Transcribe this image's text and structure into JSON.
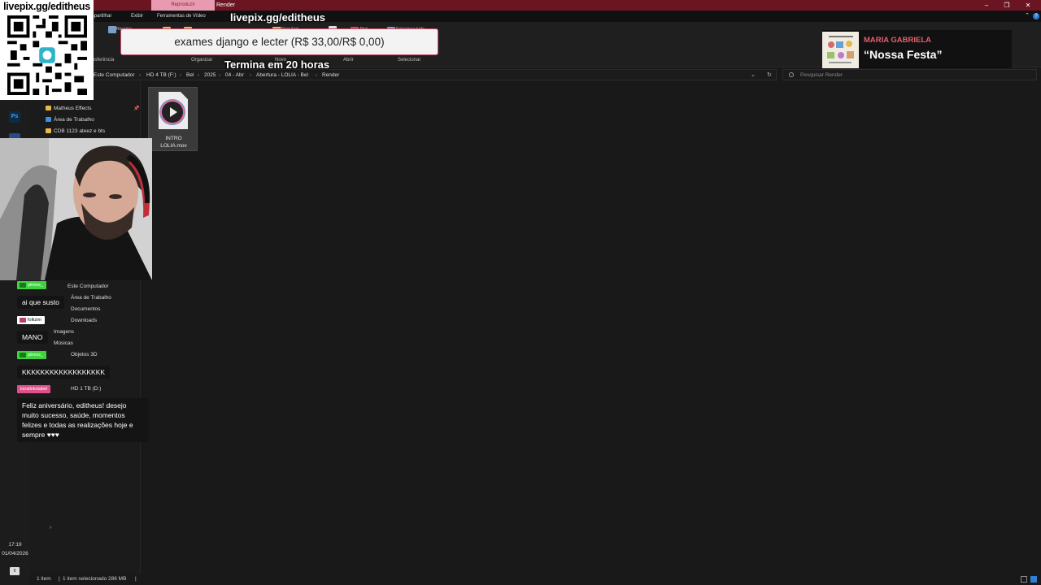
{
  "window": {
    "title": "Render",
    "context_tab": "Reproduzir",
    "controls": [
      "–",
      "❐",
      "✕"
    ]
  },
  "ribbon_tabs": {
    "share": "Compartilhar",
    "view": "Exibir",
    "video_tools": "Ferramentas de Vídeo"
  },
  "ribbon": {
    "groups": {
      "transfer": "Transferência",
      "organize": "Organizar",
      "new": "Novo",
      "open": "Abrir",
      "select": "Selecionar"
    },
    "items": {
      "cut": "Recortar",
      "new_item": "Novo item",
      "open": "Abrir",
      "select_all": "Selecionar tudo"
    }
  },
  "address": {
    "crumbs": [
      "Este Computador",
      "HD 4 TB (F:)",
      "Bel",
      "2025",
      "04 - Abr",
      "Abertura - LOLIA - Bel",
      "Render"
    ],
    "search_placeholder": "Pesquisar Render"
  },
  "taskbar": {
    "ps_label": "Ps",
    "time": "17:19",
    "date": "01/04/2026",
    "notif_count": "9"
  },
  "nav": {
    "quick_access": [
      {
        "label": "Matheus Effects",
        "color": "#e8b94a"
      },
      {
        "label": "Área de Trabalho",
        "color": "#3d8fe0"
      },
      {
        "label": "CDB 1123 ateez e bts",
        "color": "#e8b94a"
      }
    ],
    "this_pc": [
      {
        "label": "Este Computador"
      },
      {
        "label": "Área de Trabalho"
      },
      {
        "label": "Documentos"
      },
      {
        "label": "Downloads"
      },
      {
        "label": "Imagens"
      },
      {
        "label": "Músicas"
      },
      {
        "label": "Objetos 3D"
      },
      {
        "label": "HD 1 TB (D:)"
      }
    ]
  },
  "files": [
    {
      "name": "INTRO LOLIA.mov",
      "line1": "INTRO",
      "line2": "LOLIA.mov"
    }
  ],
  "status": {
    "count": "1 item",
    "selected": "1 item selecionado  286 MB"
  },
  "overlay": {
    "qr_url": "livepix.gg/editheus",
    "goal_title": "livepix.gg/editheus",
    "goal_text": "exames django e lecter (R$ 33,00/R$ 0,00)",
    "goal_ends": "Termina em 20 horas",
    "music": {
      "artist": "MARIA GABRIELA",
      "song": "“Nossa Festa”"
    }
  },
  "chat": [
    {
      "user": "piiress_",
      "badge_color": "#3fd23f",
      "message": "ai que susto"
    },
    {
      "user": "folkzim",
      "badge_color": "#ffffff",
      "message": "MANO"
    },
    {
      "user": "piiress_",
      "badge_color": "#3fd23f",
      "message": "KKKKKKKKKKKKKKKKKK"
    },
    {
      "user": "loiralinkstabel",
      "badge_color": "#e0508a",
      "message": "Feliz aniversário, editheus! desejo muito sucesso, saúde, momentos felizes e todas as realizações hoje e sempre ♥♥♥"
    }
  ],
  "colors": {
    "titlebar": "#6b1422",
    "context_tab": "#e89bb0",
    "accent_folder": "#e8b94a",
    "music_artist": "#e4606e"
  }
}
